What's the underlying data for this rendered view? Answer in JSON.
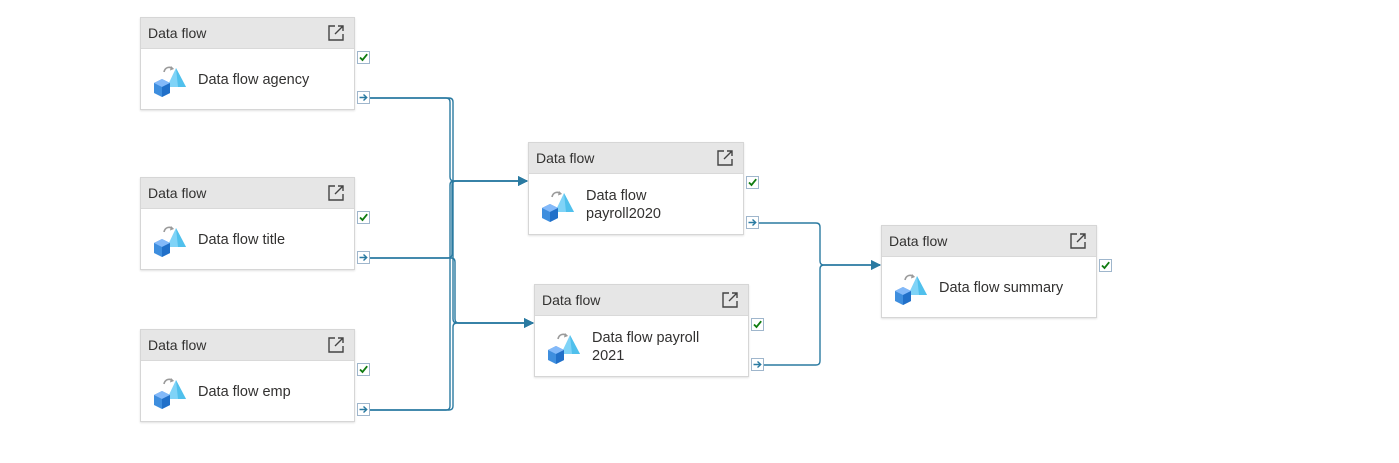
{
  "colors": {
    "link": "#2a7aa1",
    "success_check": "#107c10",
    "header_bg": "#e6e6e6"
  },
  "nodes": [
    {
      "id": "agency",
      "type": "Data flow",
      "name": "Data flow agency",
      "icon": "data-flow-icon",
      "has_output": true
    },
    {
      "id": "title",
      "type": "Data flow",
      "name": "Data flow title",
      "icon": "data-flow-icon",
      "has_output": true
    },
    {
      "id": "emp",
      "type": "Data flow",
      "name": "Data flow emp",
      "icon": "data-flow-icon",
      "has_output": true
    },
    {
      "id": "payroll2020",
      "type": "Data flow",
      "name": "Data flow payroll2020",
      "icon": "data-flow-icon",
      "has_output": true
    },
    {
      "id": "payroll2021",
      "type": "Data flow",
      "name": "Data flow payroll 2021",
      "icon": "data-flow-icon",
      "has_output": true
    },
    {
      "id": "summary",
      "type": "Data flow",
      "name": "Data flow summary",
      "icon": "data-flow-icon",
      "has_output": false
    }
  ],
  "links": [
    {
      "from": "agency",
      "to": "payroll2020"
    },
    {
      "from": "agency",
      "to": "payroll2021"
    },
    {
      "from": "title",
      "to": "payroll2020"
    },
    {
      "from": "title",
      "to": "payroll2021"
    },
    {
      "from": "emp",
      "to": "payroll2020"
    },
    {
      "from": "emp",
      "to": "payroll2021"
    },
    {
      "from": "payroll2020",
      "to": "summary"
    },
    {
      "from": "payroll2021",
      "to": "summary"
    }
  ]
}
